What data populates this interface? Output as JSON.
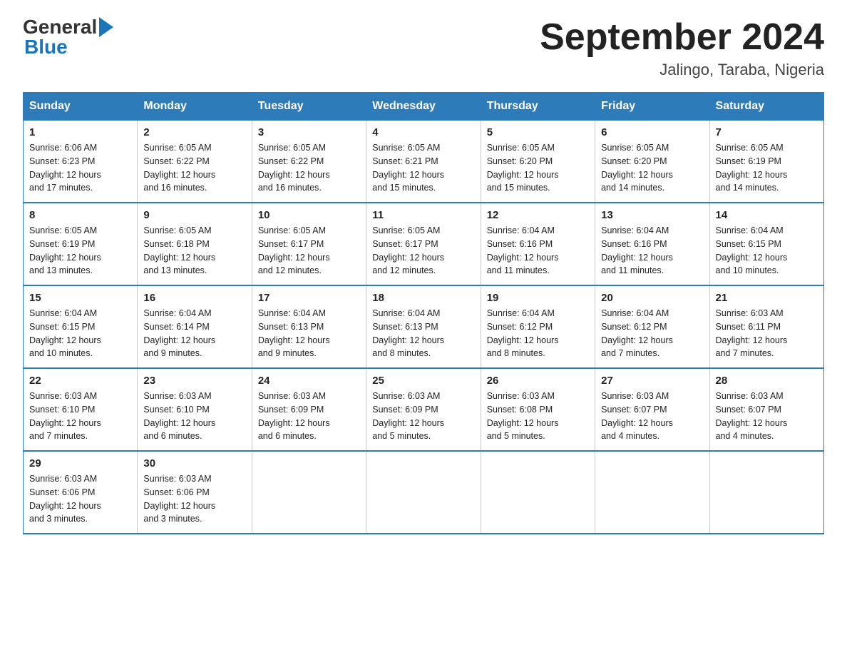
{
  "logo": {
    "general": "General",
    "blue": "Blue"
  },
  "title": "September 2024",
  "subtitle": "Jalingo, Taraba, Nigeria",
  "weekdays": [
    "Sunday",
    "Monday",
    "Tuesday",
    "Wednesday",
    "Thursday",
    "Friday",
    "Saturday"
  ],
  "weeks": [
    [
      {
        "day": "1",
        "sunrise": "6:06 AM",
        "sunset": "6:23 PM",
        "daylight": "12 hours and 17 minutes."
      },
      {
        "day": "2",
        "sunrise": "6:05 AM",
        "sunset": "6:22 PM",
        "daylight": "12 hours and 16 minutes."
      },
      {
        "day": "3",
        "sunrise": "6:05 AM",
        "sunset": "6:22 PM",
        "daylight": "12 hours and 16 minutes."
      },
      {
        "day": "4",
        "sunrise": "6:05 AM",
        "sunset": "6:21 PM",
        "daylight": "12 hours and 15 minutes."
      },
      {
        "day": "5",
        "sunrise": "6:05 AM",
        "sunset": "6:20 PM",
        "daylight": "12 hours and 15 minutes."
      },
      {
        "day": "6",
        "sunrise": "6:05 AM",
        "sunset": "6:20 PM",
        "daylight": "12 hours and 14 minutes."
      },
      {
        "day": "7",
        "sunrise": "6:05 AM",
        "sunset": "6:19 PM",
        "daylight": "12 hours and 14 minutes."
      }
    ],
    [
      {
        "day": "8",
        "sunrise": "6:05 AM",
        "sunset": "6:19 PM",
        "daylight": "12 hours and 13 minutes."
      },
      {
        "day": "9",
        "sunrise": "6:05 AM",
        "sunset": "6:18 PM",
        "daylight": "12 hours and 13 minutes."
      },
      {
        "day": "10",
        "sunrise": "6:05 AM",
        "sunset": "6:17 PM",
        "daylight": "12 hours and 12 minutes."
      },
      {
        "day": "11",
        "sunrise": "6:05 AM",
        "sunset": "6:17 PM",
        "daylight": "12 hours and 12 minutes."
      },
      {
        "day": "12",
        "sunrise": "6:04 AM",
        "sunset": "6:16 PM",
        "daylight": "12 hours and 11 minutes."
      },
      {
        "day": "13",
        "sunrise": "6:04 AM",
        "sunset": "6:16 PM",
        "daylight": "12 hours and 11 minutes."
      },
      {
        "day": "14",
        "sunrise": "6:04 AM",
        "sunset": "6:15 PM",
        "daylight": "12 hours and 10 minutes."
      }
    ],
    [
      {
        "day": "15",
        "sunrise": "6:04 AM",
        "sunset": "6:15 PM",
        "daylight": "12 hours and 10 minutes."
      },
      {
        "day": "16",
        "sunrise": "6:04 AM",
        "sunset": "6:14 PM",
        "daylight": "12 hours and 9 minutes."
      },
      {
        "day": "17",
        "sunrise": "6:04 AM",
        "sunset": "6:13 PM",
        "daylight": "12 hours and 9 minutes."
      },
      {
        "day": "18",
        "sunrise": "6:04 AM",
        "sunset": "6:13 PM",
        "daylight": "12 hours and 8 minutes."
      },
      {
        "day": "19",
        "sunrise": "6:04 AM",
        "sunset": "6:12 PM",
        "daylight": "12 hours and 8 minutes."
      },
      {
        "day": "20",
        "sunrise": "6:04 AM",
        "sunset": "6:12 PM",
        "daylight": "12 hours and 7 minutes."
      },
      {
        "day": "21",
        "sunrise": "6:03 AM",
        "sunset": "6:11 PM",
        "daylight": "12 hours and 7 minutes."
      }
    ],
    [
      {
        "day": "22",
        "sunrise": "6:03 AM",
        "sunset": "6:10 PM",
        "daylight": "12 hours and 7 minutes."
      },
      {
        "day": "23",
        "sunrise": "6:03 AM",
        "sunset": "6:10 PM",
        "daylight": "12 hours and 6 minutes."
      },
      {
        "day": "24",
        "sunrise": "6:03 AM",
        "sunset": "6:09 PM",
        "daylight": "12 hours and 6 minutes."
      },
      {
        "day": "25",
        "sunrise": "6:03 AM",
        "sunset": "6:09 PM",
        "daylight": "12 hours and 5 minutes."
      },
      {
        "day": "26",
        "sunrise": "6:03 AM",
        "sunset": "6:08 PM",
        "daylight": "12 hours and 5 minutes."
      },
      {
        "day": "27",
        "sunrise": "6:03 AM",
        "sunset": "6:07 PM",
        "daylight": "12 hours and 4 minutes."
      },
      {
        "day": "28",
        "sunrise": "6:03 AM",
        "sunset": "6:07 PM",
        "daylight": "12 hours and 4 minutes."
      }
    ],
    [
      {
        "day": "29",
        "sunrise": "6:03 AM",
        "sunset": "6:06 PM",
        "daylight": "12 hours and 3 minutes."
      },
      {
        "day": "30",
        "sunrise": "6:03 AM",
        "sunset": "6:06 PM",
        "daylight": "12 hours and 3 minutes."
      },
      null,
      null,
      null,
      null,
      null
    ]
  ],
  "labels": {
    "sunrise": "Sunrise:",
    "sunset": "Sunset:",
    "daylight": "Daylight:"
  }
}
